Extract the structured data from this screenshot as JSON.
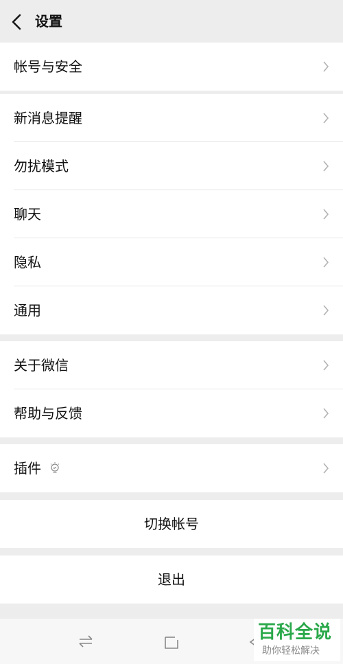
{
  "header": {
    "title": "设置"
  },
  "groups": [
    {
      "items": [
        {
          "label": "帐号与安全"
        }
      ]
    },
    {
      "items": [
        {
          "label": "新消息提醒"
        },
        {
          "label": "勿扰模式"
        },
        {
          "label": "聊天"
        },
        {
          "label": "隐私"
        },
        {
          "label": "通用"
        }
      ]
    },
    {
      "items": [
        {
          "label": "关于微信"
        },
        {
          "label": "帮助与反馈"
        }
      ]
    },
    {
      "items": [
        {
          "label": "插件"
        }
      ]
    }
  ],
  "actions": {
    "switch_account": "切换帐号",
    "logout": "退出"
  },
  "watermark": {
    "title": "百科全说",
    "subtitle": "助你轻松解决"
  },
  "colors": {
    "background": "#ededed",
    "row": "#ffffff",
    "divider": "#e5e5e5",
    "watermark_green": "#2aa84a"
  },
  "icons": [
    "back-arrow-icon",
    "chevron-right-icon",
    "bulb-icon",
    "switch-apps-icon",
    "home-square-icon",
    "back-triangle-icon"
  ]
}
